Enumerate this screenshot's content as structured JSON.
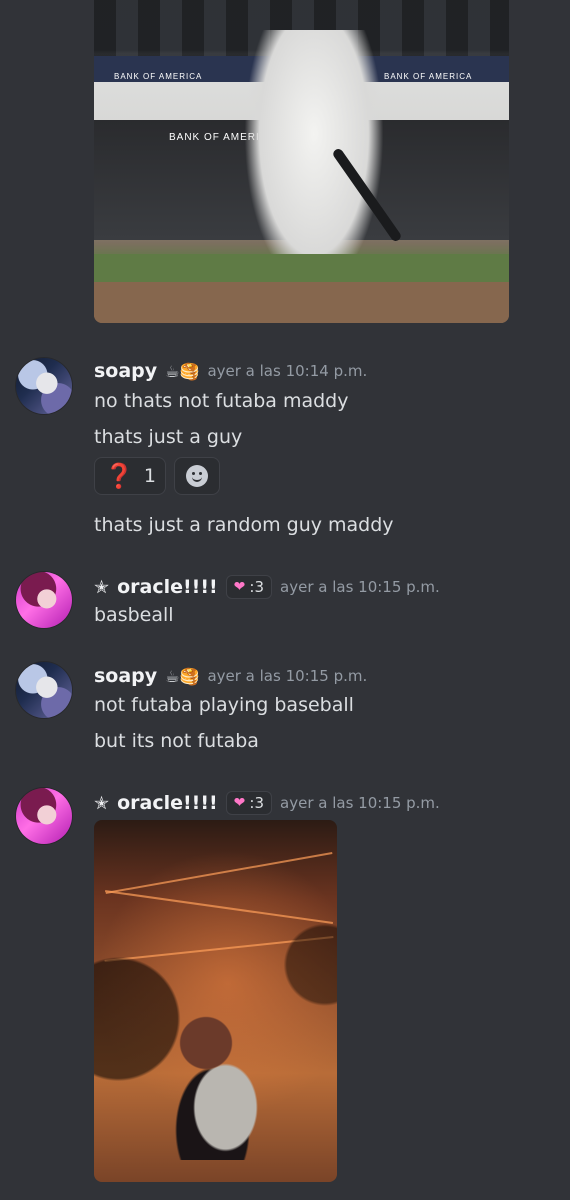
{
  "messages": [
    {
      "user": "soapy",
      "user_emoji": "☕🥞",
      "time": "ayer a las 10:14 p.m.",
      "lines": [
        "no thats not futaba maddy",
        "thats just a guy",
        "thats just a random guy maddy"
      ],
      "reactions": [
        {
          "emoji": "❓",
          "count": "1"
        }
      ]
    },
    {
      "user": "oracle!!!!",
      "user_prefix": "✭",
      "badge": {
        "icon": "❤",
        "text": ":3"
      },
      "time": "ayer a las 10:15 p.m.",
      "lines": [
        "basbeall"
      ]
    },
    {
      "user": "soapy",
      "user_emoji": "☕🥞",
      "time": "ayer a las 10:15 p.m.",
      "lines": [
        "not futaba playing baseball",
        "but its not futaba"
      ]
    },
    {
      "user": "oracle!!!!",
      "user_prefix": "✭",
      "badge": {
        "icon": "❤",
        "text": ":3"
      },
      "time": "ayer a las 10:15 p.m."
    }
  ],
  "attachments": {
    "baseball_ads": [
      "BANK OF AMERICA",
      "BANK OF AMERICA",
      "BANK OF AMERICA"
    ]
  }
}
